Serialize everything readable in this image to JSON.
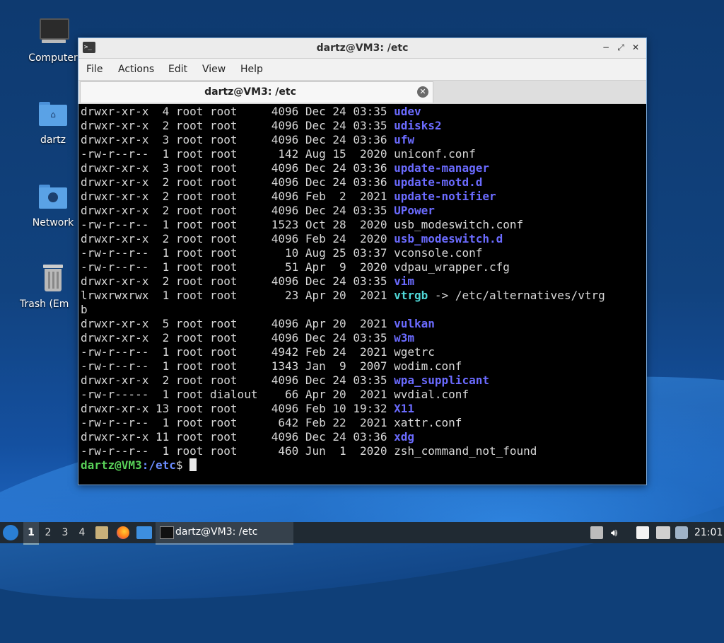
{
  "desktop": {
    "icons": [
      {
        "label": "Computer",
        "icon": "computer-icon"
      },
      {
        "label": "dartz",
        "icon": "home-folder-icon"
      },
      {
        "label": "Network",
        "icon": "network-folder-icon"
      },
      {
        "label": "Trash (Empty)",
        "icon": "trash-icon"
      }
    ]
  },
  "window": {
    "title": "dartz@VM3: /etc",
    "menu": [
      "File",
      "Actions",
      "Edit",
      "View",
      "Help"
    ],
    "tab_label": "dartz@VM3: /etc",
    "controls": {
      "minimize": "−",
      "maximize": "⤢",
      "close": "✕"
    }
  },
  "terminal": {
    "lines": [
      {
        "meta": "drwxr-xr-x  4 root root     4096 Dec 24 03:35 ",
        "name": "udev",
        "type": "dir"
      },
      {
        "meta": "drwxr-xr-x  2 root root     4096 Dec 24 03:35 ",
        "name": "udisks2",
        "type": "dir"
      },
      {
        "meta": "drwxr-xr-x  3 root root     4096 Dec 24 03:36 ",
        "name": "ufw",
        "type": "dir"
      },
      {
        "meta": "-rw-r--r--  1 root root      142 Aug 15  2020 ",
        "name": "uniconf.conf",
        "type": "file"
      },
      {
        "meta": "drwxr-xr-x  3 root root     4096 Dec 24 03:36 ",
        "name": "update-manager",
        "type": "dir"
      },
      {
        "meta": "drwxr-xr-x  2 root root     4096 Dec 24 03:36 ",
        "name": "update-motd.d",
        "type": "dir"
      },
      {
        "meta": "drwxr-xr-x  2 root root     4096 Feb  2  2021 ",
        "name": "update-notifier",
        "type": "dir"
      },
      {
        "meta": "drwxr-xr-x  2 root root     4096 Dec 24 03:35 ",
        "name": "UPower",
        "type": "dir"
      },
      {
        "meta": "-rw-r--r--  1 root root     1523 Oct 28  2020 ",
        "name": "usb_modeswitch.conf",
        "type": "file"
      },
      {
        "meta": "drwxr-xr-x  2 root root     4096 Feb 24  2020 ",
        "name": "usb_modeswitch.d",
        "type": "dir"
      },
      {
        "meta": "-rw-r--r--  1 root root       10 Aug 25 03:37 ",
        "name": "vconsole.conf",
        "type": "file"
      },
      {
        "meta": "-rw-r--r--  1 root root       51 Apr  9  2020 ",
        "name": "vdpau_wrapper.cfg",
        "type": "file"
      },
      {
        "meta": "drwxr-xr-x  2 root root     4096 Dec 24 03:35 ",
        "name": "vim",
        "type": "dir"
      },
      {
        "meta": "lrwxrwxrwx  1 root root       23 Apr 20  2021 ",
        "name": "vtrgb",
        "type": "link",
        "target": " -> /etc/alternatives/vtrg"
      },
      {
        "meta": "b",
        "name": "",
        "type": "file"
      },
      {
        "meta": "drwxr-xr-x  5 root root     4096 Apr 20  2021 ",
        "name": "vulkan",
        "type": "dir"
      },
      {
        "meta": "drwxr-xr-x  2 root root     4096 Dec 24 03:35 ",
        "name": "w3m",
        "type": "dir"
      },
      {
        "meta": "-rw-r--r--  1 root root     4942 Feb 24  2021 ",
        "name": "wgetrc",
        "type": "file"
      },
      {
        "meta": "-rw-r--r--  1 root root     1343 Jan  9  2007 ",
        "name": "wodim.conf",
        "type": "file"
      },
      {
        "meta": "drwxr-xr-x  2 root root     4096 Dec 24 03:35 ",
        "name": "wpa_supplicant",
        "type": "dir"
      },
      {
        "meta": "-rw-r-----  1 root dialout    66 Apr 20  2021 ",
        "name": "wvdial.conf",
        "type": "file"
      },
      {
        "meta": "drwxr-xr-x 13 root root     4096 Feb 10 19:32 ",
        "name": "X11",
        "type": "dir"
      },
      {
        "meta": "-rw-r--r--  1 root root      642 Feb 22  2021 ",
        "name": "xattr.conf",
        "type": "file"
      },
      {
        "meta": "drwxr-xr-x 11 root root     4096 Dec 24 03:36 ",
        "name": "xdg",
        "type": "dir"
      },
      {
        "meta": "-rw-r--r--  1 root root      460 Jun  1  2020 ",
        "name": "zsh_command_not_found",
        "type": "file"
      }
    ],
    "prompt": {
      "user_host": "dartz@VM3",
      "path": ":/etc",
      "symbol": "$ "
    }
  },
  "taskbar": {
    "workspaces": [
      "1",
      "2",
      "3",
      "4"
    ],
    "active_workspace": "1",
    "launchers": [
      "file-manager-icon",
      "firefox-icon",
      "show-desktop-icon"
    ],
    "task_label": "dartz@VM3: /etc",
    "tray_icons": [
      "update-icon",
      "volume-icon",
      "clipboard-icon",
      "network-icon",
      "notification-icon"
    ],
    "clock": "21:01"
  },
  "colors": {
    "dir": "#6b6bff",
    "link": "#4fd6d6",
    "prompt_user": "#58d058",
    "taskbar": "#202a33"
  }
}
